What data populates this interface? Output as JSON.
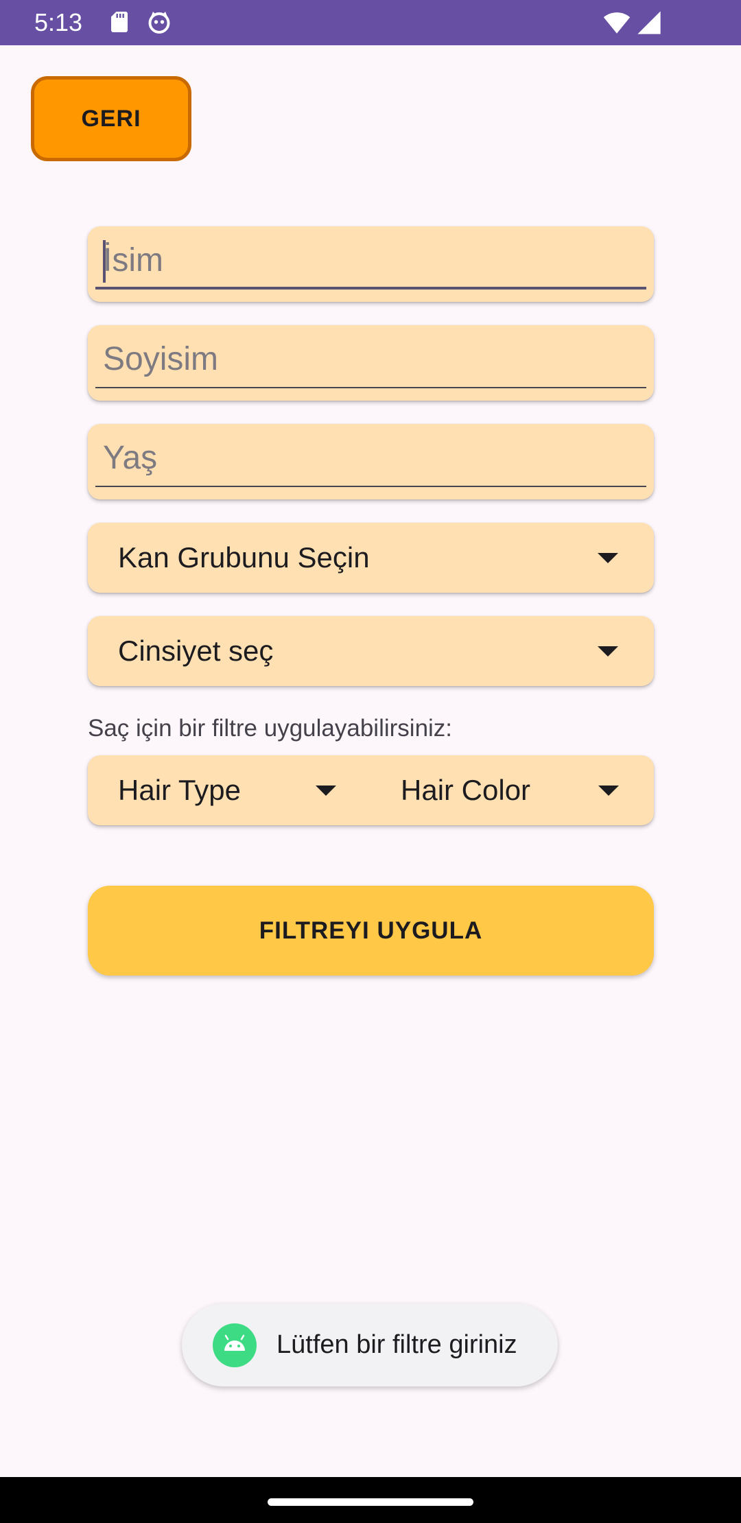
{
  "status_bar": {
    "time": "5:13",
    "icons": [
      "sd-card-icon",
      "cat-face-icon",
      "wifi-icon",
      "signal-icon"
    ],
    "background_color": "#6750a4"
  },
  "back_button": {
    "label": "GERI",
    "color": "#ff9800"
  },
  "form": {
    "name_field": {
      "placeholder": "İsim",
      "focused": true
    },
    "surname_field": {
      "placeholder": "Soyisim"
    },
    "age_field": {
      "placeholder": "Yaş"
    },
    "blood_group_dropdown": {
      "selected": "Kan Grubunu Seçin"
    },
    "gender_dropdown": {
      "selected": "Cinsiyet seç"
    },
    "field_background_color": "#ffe0b2"
  },
  "hair_filter": {
    "hint": "Saç için bir filtre uygulayabilirsiniz:",
    "hair_type": {
      "selected": "Hair Type"
    },
    "hair_color": {
      "selected": "Hair Color"
    }
  },
  "apply_button": {
    "label": "FILTREYI UYGULA",
    "color": "#ffc846"
  },
  "toast": {
    "icon": "android-icon",
    "message": "Lütfen bir filtre giriniz"
  }
}
